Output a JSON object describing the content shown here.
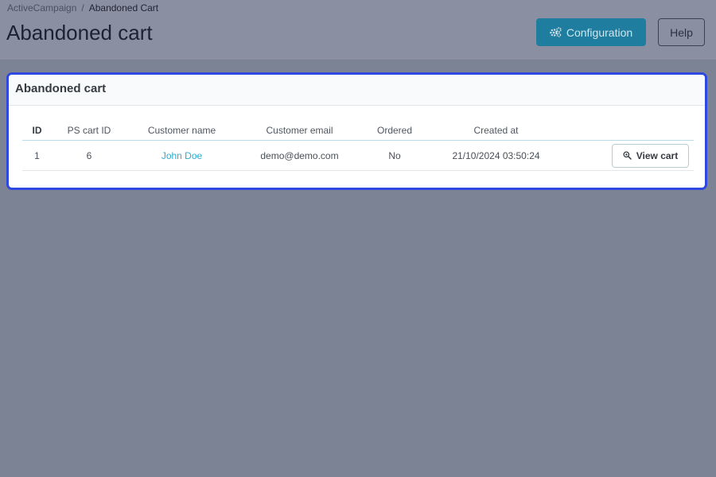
{
  "breadcrumb": {
    "root": "ActiveCampaign",
    "separator": "/",
    "current": "Abandoned Cart"
  },
  "header": {
    "title": "Abandoned cart",
    "config_label": "Configuration",
    "help_label": "Help"
  },
  "card": {
    "title": "Abandoned cart",
    "columns": [
      "ID",
      "PS cart ID",
      "Customer name",
      "Customer email",
      "Ordered",
      "Created at"
    ],
    "rows": [
      {
        "id": "1",
        "ps_cart_id": "6",
        "customer_name": "John Doe",
        "customer_email": "demo@demo.com",
        "ordered": "No",
        "created_at": "21/10/2024 03:50:24",
        "action_label": "View cart"
      }
    ]
  },
  "colors": {
    "overlay": "#7c8395",
    "primary_button": "#1f7d9f",
    "highlight_border": "#2f48e0",
    "link": "#2eacce"
  },
  "icons": {
    "config": "gears-icon",
    "view": "magnifier-icon"
  }
}
